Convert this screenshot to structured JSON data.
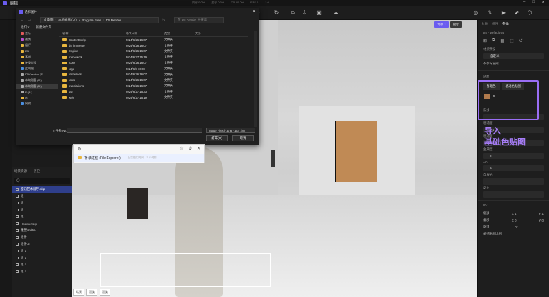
{
  "app": {
    "title": "编辑",
    "stats": [
      "内存 0.0%",
      "显存 0.0%",
      "CPU 0.0%",
      "FPS 0",
      "1:0"
    ]
  },
  "viewport": {
    "tabs": [
      {
        "label": "场景 1",
        "active": true
      },
      {
        "label": "提示",
        "active": false
      }
    ],
    "status_chips": [
      "场景",
      "渲染",
      "渲染"
    ],
    "status_text": "Ctrl+S"
  },
  "left_panel": {
    "tabs": [
      "场景资源",
      "历史"
    ],
    "search_placeholder": "Q",
    "items": [
      {
        "label": "室内艺术展厅.skp",
        "selected": true
      },
      {
        "label": "组",
        "selected": false
      },
      {
        "label": "组",
        "selected": false
      },
      {
        "label": "组",
        "selected": false
      },
      {
        "label": "组",
        "selected": false
      },
      {
        "label": "Hoomer.skp",
        "selected": false
      },
      {
        "label": "雕塑 2 d5a",
        "selected": false
      },
      {
        "label": "组件",
        "selected": false
      },
      {
        "label": "组件 2",
        "selected": false
      },
      {
        "label": "组 1",
        "selected": false
      },
      {
        "label": "组 1",
        "selected": false
      },
      {
        "label": "组 1",
        "selected": false
      },
      {
        "label": "组 1",
        "selected": false
      }
    ]
  },
  "right_panel": {
    "tabs": [
      "材质",
      "组件",
      "参数"
    ],
    "active_tab": "参数",
    "material_name": "D5 - Default-54",
    "preset_label": "材质预设",
    "preset_value": "自定义",
    "checkbox_label": "不参与渲染",
    "section_albedo": "贴图",
    "albedo_buttons": [
      "基础色",
      "基础色贴图"
    ],
    "sections": [
      {
        "label": "法线",
        "value": ""
      },
      {
        "label": "粗糙度",
        "value": "0.5"
      },
      {
        "label": "粗糙度",
        "value": "0.4"
      },
      {
        "label": "金属度",
        "value": "0"
      },
      {
        "label": "AO",
        "value": "0"
      },
      {
        "label": "自发光",
        "value": ""
      },
      {
        "label": "反射",
        "value": ""
      }
    ],
    "uv_section": "UV",
    "uv_rows": [
      {
        "label": "缩放",
        "x": "X 1",
        "y": "Y 1"
      },
      {
        "label": "偏移",
        "x": "X 0",
        "y": "Y 0"
      },
      {
        "label": "旋转",
        "x": "0°",
        "y": ""
      },
      {
        "label": "保持贴图比例",
        "x": "",
        "y": ""
      }
    ],
    "highlight_color": "#9a6ef5"
  },
  "annotation": {
    "line1": "导入",
    "line2": "基础色贴图",
    "color": "#a67df7"
  },
  "file_dialog": {
    "title": "选择图片",
    "path": [
      "此电脑",
      "本地磁盘 (D:)",
      "Program Files",
      "D5 Render"
    ],
    "search_placeholder": "在 D5 Render 中搜索",
    "commands": [
      "组织 ▾",
      "新建文件夹"
    ],
    "tree": [
      {
        "label": "音乐",
        "color": "#e05a5a"
      },
      {
        "label": "视频",
        "color": "#b84fd0"
      },
      {
        "label": "展厅",
        "color": "#e8b63e"
      },
      {
        "label": "D5",
        "color": "#e8b63e"
      },
      {
        "label": "素材",
        "color": "#e8b63e"
      },
      {
        "label": "补录过程",
        "color": "#e8b63e"
      },
      {
        "label": "此电脑",
        "color": "#4a8fe0"
      },
      {
        "label": "D5Creative (F)",
        "color": "#aaa"
      },
      {
        "label": "本地磁盘 (C:)",
        "color": "#aaa"
      },
      {
        "label": "本地磁盘 (D:)",
        "color": "#aaa"
      },
      {
        "label": "F (F:)",
        "color": "#aaa"
      },
      {
        "label": "库",
        "color": "#e8b63e"
      },
      {
        "label": "网络",
        "color": "#4a8fe0"
      }
    ],
    "columns": [
      "名称",
      "修改日期",
      "类型",
      "大小"
    ],
    "rows": [
      {
        "name": "ContentScript",
        "date": "2024/6/26 16:07",
        "type": "文件夹",
        "size": ""
      },
      {
        "name": "d5_immerse",
        "date": "2024/6/26 16:07",
        "type": "文件夹",
        "size": ""
      },
      {
        "name": "Engine",
        "date": "2024/6/26 16:07",
        "type": "文件夹",
        "size": ""
      },
      {
        "name": "framework",
        "date": "2024/6/27 15:19",
        "type": "文件夹",
        "size": ""
      },
      {
        "name": "icons",
        "date": "2024/6/26 16:07",
        "type": "文件夹",
        "size": ""
      },
      {
        "name": "logo",
        "date": "2024/6/8 16:08",
        "type": "文件夹",
        "size": ""
      },
      {
        "name": "resources",
        "date": "2024/6/26 16:07",
        "type": "文件夹",
        "size": ""
      },
      {
        "name": "tools",
        "date": "2024/6/26 16:07",
        "type": "文件夹",
        "size": ""
      },
      {
        "name": "translations",
        "date": "2024/6/26 16:07",
        "type": "文件夹",
        "size": ""
      },
      {
        "name": "usr",
        "date": "2024/6/27 15:33",
        "type": "文件夹",
        "size": ""
      },
      {
        "name": "web",
        "date": "2024/6/27 15:19",
        "type": "文件夹",
        "size": ""
      }
    ],
    "filename_label": "文件名(N):",
    "filename_value": "",
    "filetype": "Image Files (*.png *.jpg *.bm",
    "open_button": "打开(O)",
    "cancel_button": "取消"
  },
  "explorer_popup": {
    "title_icon": "settings",
    "item": "补录过程 (File Explorer)",
    "item_hint": "上次使用时间 - 3 小时前"
  }
}
